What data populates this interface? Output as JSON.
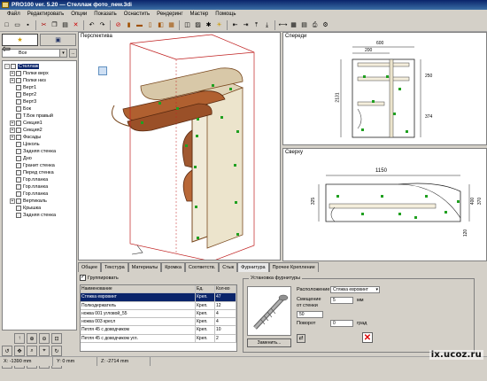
{
  "window": {
    "title": "PRO100 ver. 5.20 — Стеллаж фото_new.3di"
  },
  "menu": [
    "Файл",
    "Редактировать",
    "Опции",
    "Показать",
    "Оснастить",
    "Рендеринг",
    "Мастер",
    "Помощь"
  ],
  "left": {
    "combo_value": "Все",
    "combo_btn": "...",
    "tree": [
      {
        "label": "Стеллаж",
        "exp": "-",
        "sel": true,
        "level": 0
      },
      {
        "label": "Полки верх",
        "exp": "+",
        "level": 1
      },
      {
        "label": "Полки низ",
        "exp": "+",
        "level": 1
      },
      {
        "label": "Верт1",
        "exp": "",
        "level": 1
      },
      {
        "label": "Верт2",
        "exp": "",
        "level": 1
      },
      {
        "label": "Верт3",
        "exp": "",
        "level": 1
      },
      {
        "label": "Бок",
        "exp": "",
        "level": 1
      },
      {
        "label": "Т.Бок правый",
        "exp": "",
        "level": 1
      },
      {
        "label": "Секция1",
        "exp": "+",
        "level": 1
      },
      {
        "label": "Секция2",
        "exp": "+",
        "level": 1
      },
      {
        "label": "Фасады",
        "exp": "+",
        "level": 1
      },
      {
        "label": "Цоколь",
        "exp": "",
        "level": 1
      },
      {
        "label": "Задняя стенка",
        "exp": "",
        "level": 1
      },
      {
        "label": "Дно",
        "exp": "",
        "level": 1
      },
      {
        "label": "Гранит стенка",
        "exp": "",
        "level": 1
      },
      {
        "label": "Перед стенка",
        "exp": "",
        "level": 1
      },
      {
        "label": "Гор.планка",
        "exp": "",
        "level": 1
      },
      {
        "label": "Гор.планка",
        "exp": "",
        "level": 1
      },
      {
        "label": "Гор.планка",
        "exp": "",
        "level": 1
      },
      {
        "label": "Вертикаль",
        "exp": "+",
        "level": 1
      },
      {
        "label": "Крышка",
        "exp": "",
        "level": 1
      },
      {
        "label": "Задняя стенка",
        "exp": "",
        "level": 1
      }
    ]
  },
  "views": {
    "perspective": "Перспектива",
    "front": "Спереди",
    "top": "Сверху",
    "dims_front": [
      "600",
      "200",
      "250",
      "374",
      "2131"
    ],
    "dims_top": [
      "1150",
      "400",
      "120",
      "370",
      "325"
    ]
  },
  "bottom": {
    "tabs": [
      "Общее",
      "Текстура",
      "Материалы",
      "Кромка",
      "Соответств.",
      "Стык",
      "Фурнитура",
      "Прочее Крепление"
    ],
    "active_tab": 6,
    "group_check": "Группировать",
    "columns": [
      "Наименование",
      "Ед.",
      "Кол-во"
    ],
    "rows": [
      {
        "name": "Стяжка евровинт",
        "unit": "Креп.",
        "qty": "47",
        "sel": true
      },
      {
        "name": "Полкодержатель",
        "unit": "Креп.",
        "qty": "12"
      },
      {
        "name": "ножка 001 угловой_55",
        "unit": "Креп.",
        "qty": "4"
      },
      {
        "name": "ножка 003 кресл",
        "unit": "Креп.",
        "qty": "4"
      },
      {
        "name": "Петля 45 с доводчиком",
        "unit": "Креп.",
        "qty": "10"
      },
      {
        "name": "Петля 45 с доводчиком угл.",
        "unit": "Креп.",
        "qty": "2"
      }
    ],
    "fastener": {
      "legend": "Установка фурнитуры",
      "placement_label": "Расположение",
      "placement_value": "Стяжка евровинт",
      "offset_label": "Смещение",
      "offset_value": "5",
      "offset_unit": "мм",
      "from_edge_label": "от стенки",
      "from_edge_value": "50",
      "rotate_label": "Поворот",
      "rotate_value": "0",
      "rotate_unit": "град",
      "change_btn": "Заменить..."
    }
  },
  "status": {
    "x": "X: -1390 mm",
    "y": "Y: 0 mm",
    "z": "Z: -2714 mm"
  },
  "watermark": "ix.ucoz.ru"
}
